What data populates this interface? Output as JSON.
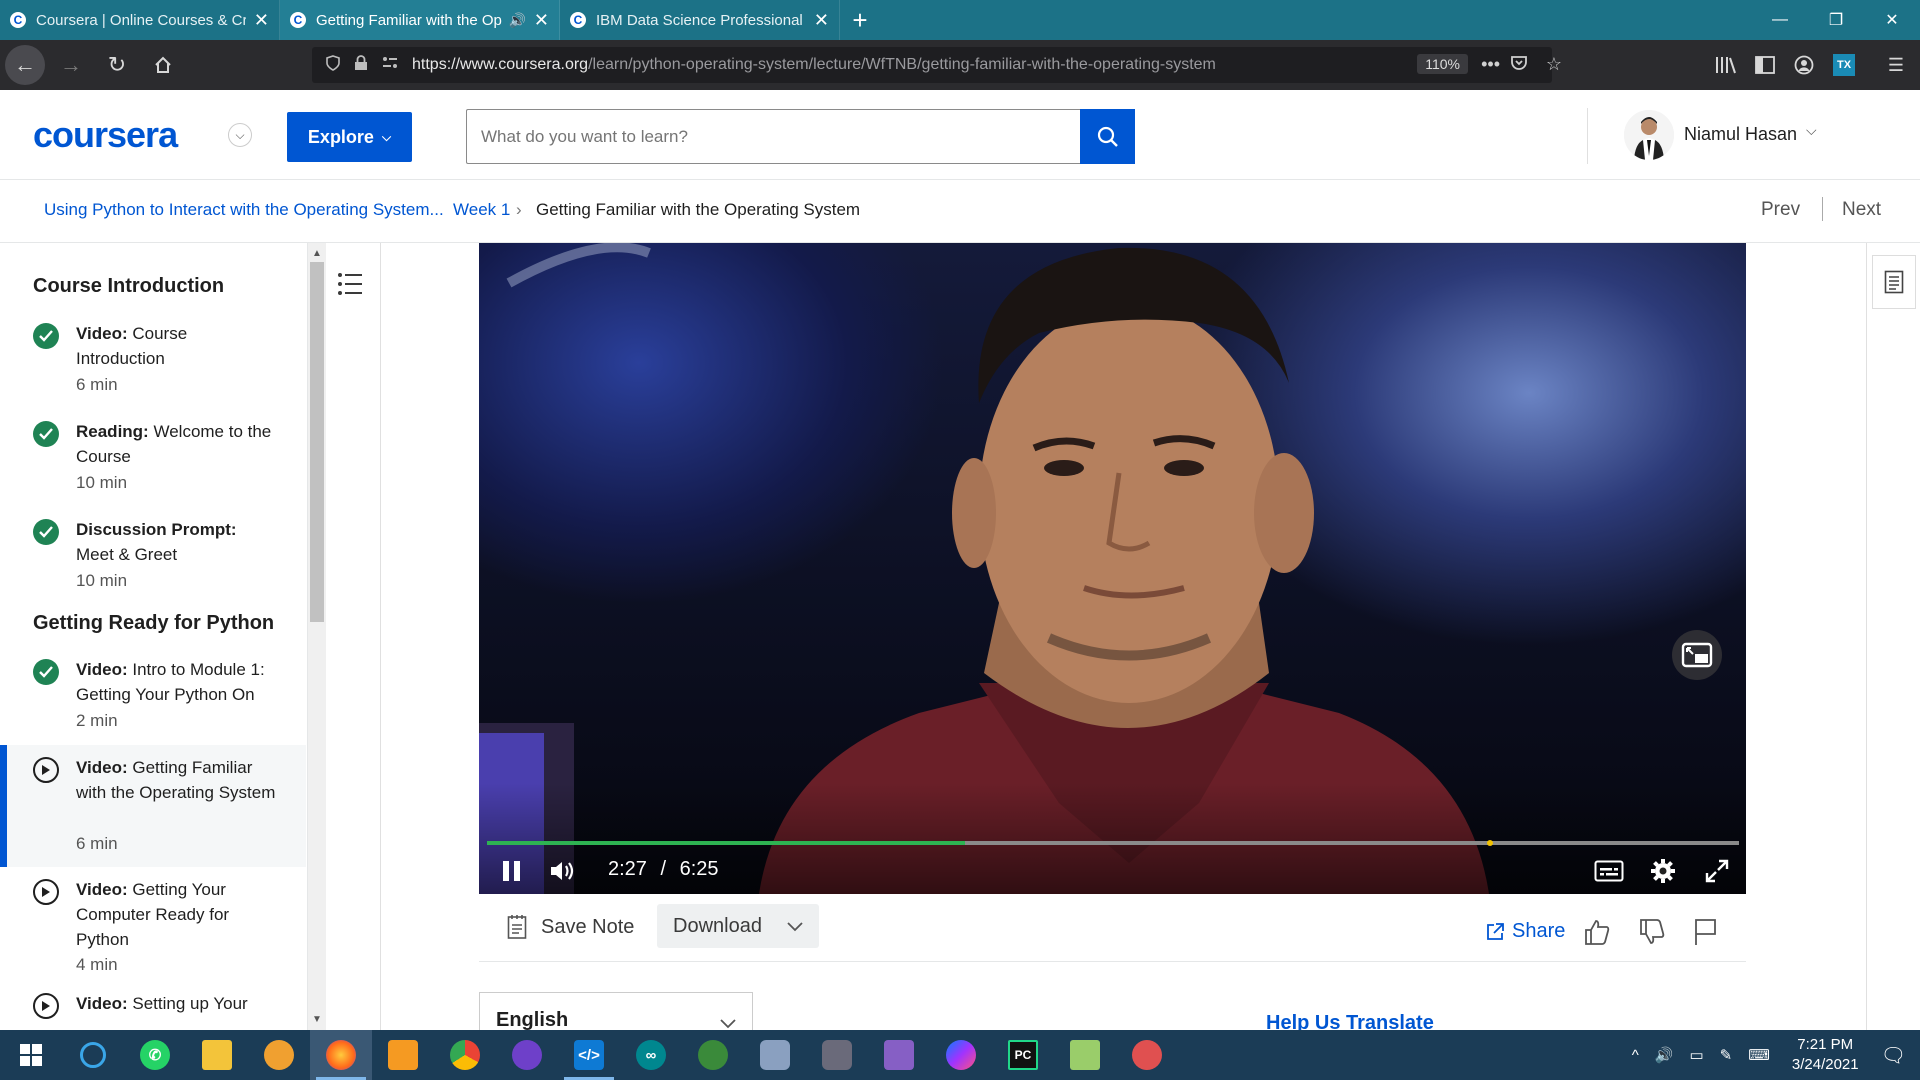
{
  "browser": {
    "tabs": [
      {
        "title": "Coursera | Online Courses & Cr",
        "active": false
      },
      {
        "title": "Getting Familiar with the Op",
        "active": true,
        "audio": true
      },
      {
        "title": "IBM Data Science Professional",
        "active": false
      }
    ],
    "favicon_letter": "C",
    "new_tab": "+",
    "url_domain": "https://www.coursera.org",
    "url_path": "/learn/python-operating-system/lecture/WfTNB/getting-familiar-with-the-operating-system",
    "zoom": "110%"
  },
  "header": {
    "logo": "coursera",
    "explore_label": "Explore",
    "search_placeholder": "What do you want to learn?",
    "user_name": "Niamul Hasan"
  },
  "breadcrumb": {
    "course": "Using Python to Interact with the Operating System...",
    "week": "Week 1",
    "separator": "›",
    "current": "Getting Familiar with the Operating System",
    "prev": "Prev",
    "next": "Next"
  },
  "sidebar": {
    "sections": [
      {
        "title": "Course Introduction"
      },
      {
        "title": "Getting Ready for Python"
      }
    ],
    "items": [
      {
        "type": "Video:",
        "title": "Course Introduction",
        "duration": "6 min",
        "done": true
      },
      {
        "type": "Reading:",
        "title": "Welcome to the Course",
        "duration": "10 min",
        "done": true
      },
      {
        "type": "Discussion Prompt:",
        "title": "Meet & Greet",
        "duration": "10 min",
        "done": true
      },
      {
        "type": "Video:",
        "title": "Intro to Module 1: Getting Your Python On",
        "duration": "2 min",
        "done": true
      },
      {
        "type": "Video:",
        "title": "Getting Familiar with the Operating System",
        "duration": "6 min",
        "done": false,
        "active": true
      },
      {
        "type": "Video:",
        "title": "Getting Your Computer Ready for Python",
        "duration": "4 min",
        "done": false
      },
      {
        "type": "Video:",
        "title": "Setting up Your",
        "duration": "",
        "done": false
      }
    ]
  },
  "video": {
    "current_time": "2:27",
    "separator": "/",
    "total_time": "6:25",
    "progress": 0.382
  },
  "actions": {
    "save_note": "Save Note",
    "download": "Download",
    "share": "Share"
  },
  "transcript": {
    "language": "English",
    "help_translate": "Help Us Translate"
  },
  "taskbar": {
    "time": "7:21 PM",
    "date": "3/24/2021"
  },
  "colors": {
    "brand": "#0056d2",
    "check": "#1f8354",
    "tabbar": "#1c7287",
    "taskbar": "#1b3c56"
  }
}
